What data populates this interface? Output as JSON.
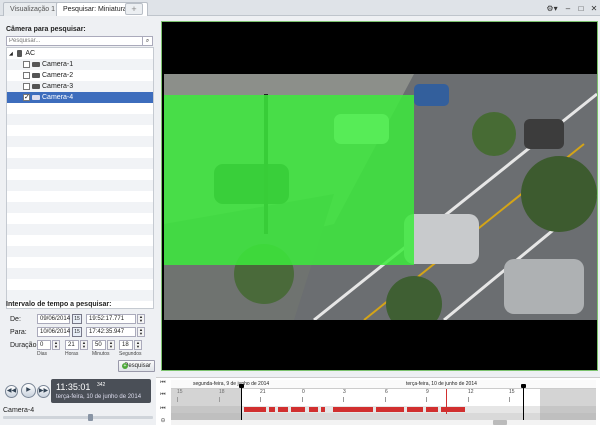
{
  "tabs": [
    {
      "label": "Visualização 1",
      "active": false
    },
    {
      "label": "Pesquisar: Miniaturas",
      "active": true
    }
  ],
  "tab_add_icon": "plus-icon",
  "window_controls": {
    "settings": "⚙▾",
    "minimize": "–",
    "maximize": "□",
    "close": "✕"
  },
  "left": {
    "camera_heading": "Câmera para pesquisar:",
    "search_placeholder": "Pesquisar...",
    "tree": [
      {
        "label": "AC",
        "level": 0,
        "checked": false,
        "selected": false
      },
      {
        "label": "Camera-1",
        "level": 1,
        "checked": false,
        "selected": false
      },
      {
        "label": "Camera-2",
        "level": 1,
        "checked": false,
        "selected": false
      },
      {
        "label": "Camera-3",
        "level": 1,
        "checked": false,
        "selected": false
      },
      {
        "label": "Camera-4",
        "level": 1,
        "checked": true,
        "selected": true
      }
    ],
    "interval_heading": "Intervalo de tempo a pesquisar:",
    "from_label": "De:",
    "from_date": "09/06/2014",
    "from_time": "19:52:17.771",
    "to_label": "Para:",
    "to_date": "10/06/2014",
    "to_time": "17:42:35.947",
    "duration_label": "Duração:",
    "duration": {
      "days": "0",
      "hours": "21",
      "minutes": "50",
      "seconds": "18"
    },
    "duration_units": {
      "days": "Dias",
      "hours": "Horas",
      "minutes": "Minutos",
      "seconds": "Segundos"
    },
    "search_button": "Pesquisar"
  },
  "playback": {
    "time": "11:35:01",
    "ms": "342",
    "date": "terça-feira, 10 de junho de 2014",
    "camera": "Camera-4"
  },
  "timeline": {
    "day1": "segunda-feira, 9 de junho de 2014",
    "day2": "terça-feira, 10 de junho de 2014",
    "ticks": [
      "15",
      "18",
      "21",
      "0",
      "3",
      "6",
      "9",
      "12",
      "15"
    ]
  },
  "colors": {
    "accent": "#3d6dbd",
    "overlay": "#3ceb3c",
    "recording": "#d12f2f"
  }
}
